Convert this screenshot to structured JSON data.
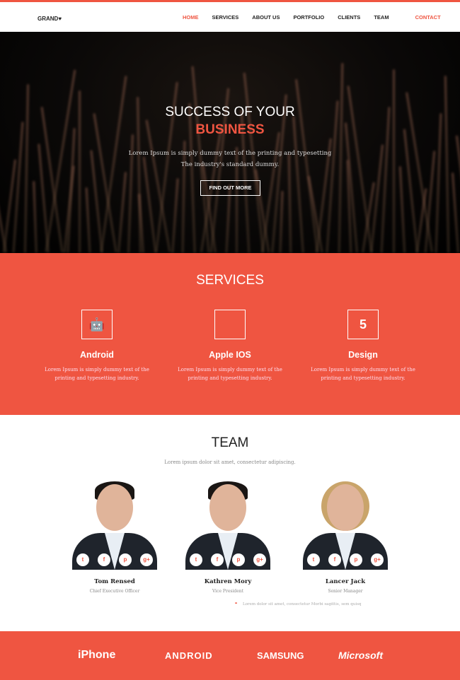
{
  "brand": {
    "logo": "GRAND",
    "accent": "#ef5541"
  },
  "nav": {
    "items": [
      "HOME",
      "SERVICES",
      "ABOUT US",
      "PORTFOLIO",
      "CLIENTS",
      "TEAM"
    ],
    "contact": "CONTACT",
    "active": "HOME"
  },
  "hero": {
    "title": "SUCCESS OF YOUR",
    "highlight": "BUSINESS",
    "line1": "Lorem Ipsum is simply dummy text of the printing and typesetting",
    "line2": "The industry's standard dummy.",
    "button": "FIND OUT MORE"
  },
  "services": {
    "title": "SERVICES",
    "items": [
      {
        "icon": "android-icon",
        "glyph": "🤖",
        "title": "Android",
        "line1": "Lorem Ipsum is simply dummy text of the",
        "line2": "printing and typesetting industry."
      },
      {
        "icon": "apple-icon",
        "glyph": "",
        "title": "Apple IOS",
        "line1": "Lorem Ipsum is simply dummy text of the",
        "line2": "printing and typesetting industry."
      },
      {
        "icon": "html5-icon",
        "glyph": "5",
        "title": "Design",
        "line1": "Lorem Ipsum is simply dummy text of the",
        "line2": "printing and typesetting industry."
      }
    ]
  },
  "team": {
    "title": "TEAM",
    "subtitle": "Lorem ipsum dolor sit amet, consectetur adipiscing.",
    "members": [
      {
        "name": "Tom Rensed",
        "role": "Chief Executive Officer"
      },
      {
        "name": "Kathren Mory",
        "role": "Vice President"
      },
      {
        "name": "Lancer Jack",
        "role": "Senior Manager"
      }
    ],
    "socials": [
      "t",
      "f",
      "p",
      "g+"
    ],
    "quote": "Lorem dolor sit amet, consectetur Morbi sagittis, sem quisq"
  },
  "clients": [
    "iPhone",
    "ANDROID",
    "SAMSUNG",
    "Microsoft"
  ]
}
